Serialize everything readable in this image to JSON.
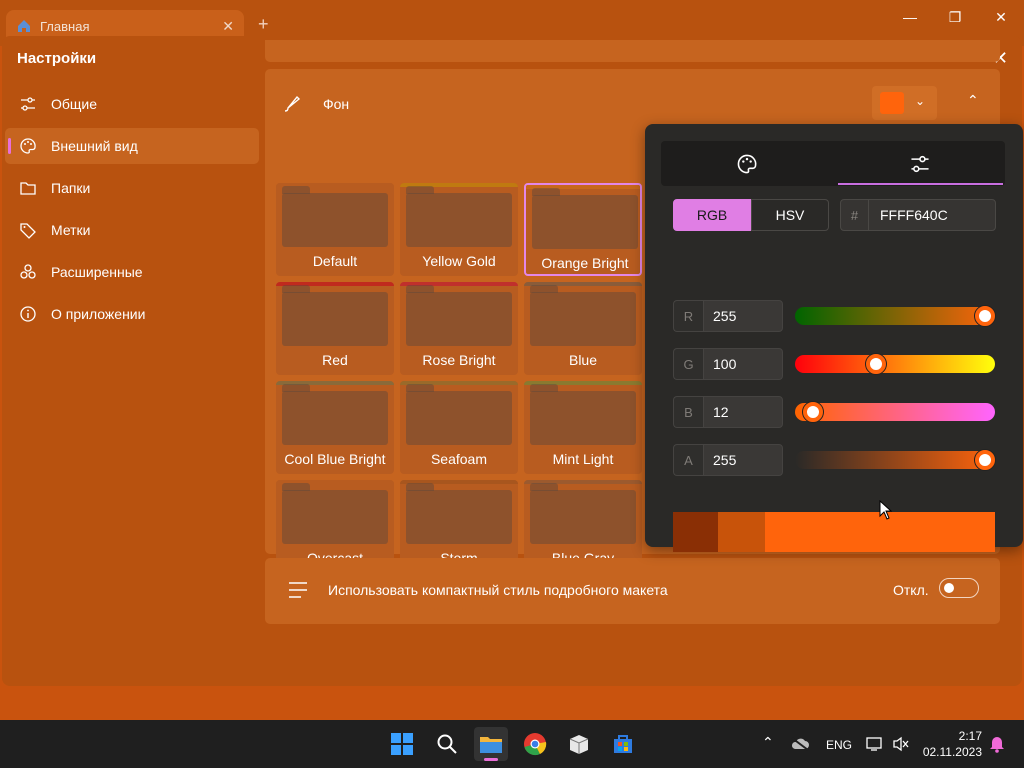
{
  "window": {
    "tab_title": "Главная",
    "tab_close": "✕",
    "new_tab": "+",
    "minimize": "—",
    "maximize": "❐",
    "close": "✕"
  },
  "settings": {
    "title": "Настройки",
    "close": "✕",
    "nav": [
      {
        "label": "Общие",
        "icon": "sliders-icon"
      },
      {
        "label": "Внешний вид",
        "icon": "palette-icon",
        "selected": true
      },
      {
        "label": "Папки",
        "icon": "folder-icon"
      },
      {
        "label": "Метки",
        "icon": "tag-icon"
      },
      {
        "label": "Расширенные",
        "icon": "advanced-icon"
      },
      {
        "label": "О приложении",
        "icon": "info-icon"
      }
    ],
    "background": {
      "label": "Фон",
      "swatch_color": "#FF640C"
    },
    "themes": [
      {
        "name": "Default",
        "top": "#b85c20"
      },
      {
        "name": "Yellow Gold",
        "top": "#c07a10"
      },
      {
        "name": "Orange Bright",
        "top": "#c8681c",
        "selected": true
      },
      {
        "name": "Red",
        "top": "#c02a1e"
      },
      {
        "name": "Rose Bright",
        "top": "#c0302c"
      },
      {
        "name": "Blue",
        "top": "#8a5c3a"
      },
      {
        "name": "Cool Blue Bright",
        "top": "#8a6a3a"
      },
      {
        "name": "Seafoam",
        "top": "#9a6a2a"
      },
      {
        "name": "Mint Light",
        "top": "#8a7a30"
      },
      {
        "name": "Overcast",
        "top": "#b85c20"
      },
      {
        "name": "Storm",
        "top": "#a8561e"
      },
      {
        "name": "Blue Gray",
        "top": "#9c5a2e"
      }
    ],
    "compact": {
      "label": "Использовать компактный стиль подробного макета",
      "state": "Откл.",
      "on": false
    }
  },
  "picker": {
    "mode_rgb": "RGB",
    "mode_hsv": "HSV",
    "hash": "#",
    "hex": "FFFF640C",
    "channels": [
      {
        "key": "R",
        "value": "255",
        "level": 255
      },
      {
        "key": "G",
        "value": "100",
        "level": 100
      },
      {
        "key": "B",
        "value": "12",
        "level": 12
      },
      {
        "key": "A",
        "value": "255",
        "level": 255
      }
    ],
    "preview_colors": [
      "#8a2f05",
      "#c8530a",
      "#ff640c"
    ]
  },
  "taskbar": {
    "lang": "ENG",
    "time": "2:17",
    "date": "02.11.2023"
  }
}
